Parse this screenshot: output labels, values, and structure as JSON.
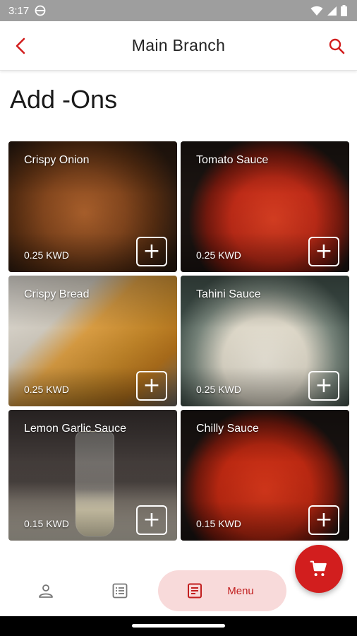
{
  "status_bar": {
    "time": "3:17"
  },
  "header": {
    "title": "Main Branch"
  },
  "page": {
    "title": "Add -Ons"
  },
  "items": [
    {
      "name": "Crispy Onion",
      "price": "0.25 KWD"
    },
    {
      "name": "Tomato Sauce",
      "price": "0.25 KWD"
    },
    {
      "name": "Crispy Bread",
      "price": "0.25 KWD"
    },
    {
      "name": "Tahini Sauce",
      "price": "0.25 KWD"
    },
    {
      "name": "Lemon Garlic Sauce",
      "price": "0.15 KWD"
    },
    {
      "name": "Chilly Sauce",
      "price": "0.15 KWD"
    }
  ],
  "add_button": {
    "symbol": "+"
  },
  "bottom_nav": {
    "menu_label": "Menu"
  },
  "colors": {
    "accent": "#d21e1e",
    "menu_pill": "#f8dada"
  },
  "icons": {
    "back": "chevron-left-icon",
    "search": "search-icon",
    "cart": "cart-icon",
    "profile": "person-icon",
    "list": "list-icon",
    "menu": "document-icon"
  }
}
